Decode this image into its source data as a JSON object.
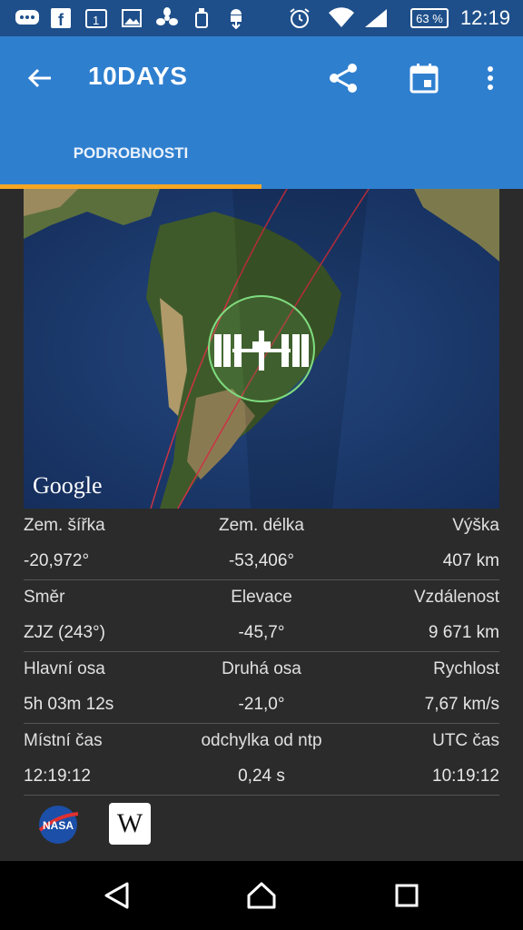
{
  "status_bar": {
    "battery": "63 %",
    "time": "12:19"
  },
  "toolbar": {
    "title": "10DAYS"
  },
  "tabs": [
    {
      "label": "PODROBNOSTI"
    }
  ],
  "map": {
    "attribution": "Google"
  },
  "details": {
    "rows": [
      {
        "labels": [
          "Zem. šířka",
          "Zem. délka",
          "Výška"
        ],
        "values": [
          "-20,972°",
          "-53,406°",
          "407 km"
        ]
      },
      {
        "labels": [
          "Směr",
          "Elevace",
          "Vzdálenost"
        ],
        "values": [
          "ZJZ (243°)",
          "-45,7°",
          "9 671 km"
        ]
      },
      {
        "labels": [
          "Hlavní osa",
          "Druhá osa",
          "Rychlost"
        ],
        "values": [
          "5h 03m 12s",
          "-21,0°",
          "7,67 km/s"
        ]
      },
      {
        "labels": [
          "Místní čas",
          "odchylka od ntp",
          "UTC čas"
        ],
        "values": [
          "12:19:12",
          "0,24 s",
          "10:19:12"
        ]
      }
    ]
  },
  "links": {
    "nasa_logo": "NASA",
    "wikipedia_logo": "W"
  },
  "colors": {
    "status_bar": "#1e4f8a",
    "toolbar": "#2f7fcf",
    "tab_indicator": "#f5a623",
    "background": "#2b2b2b"
  }
}
